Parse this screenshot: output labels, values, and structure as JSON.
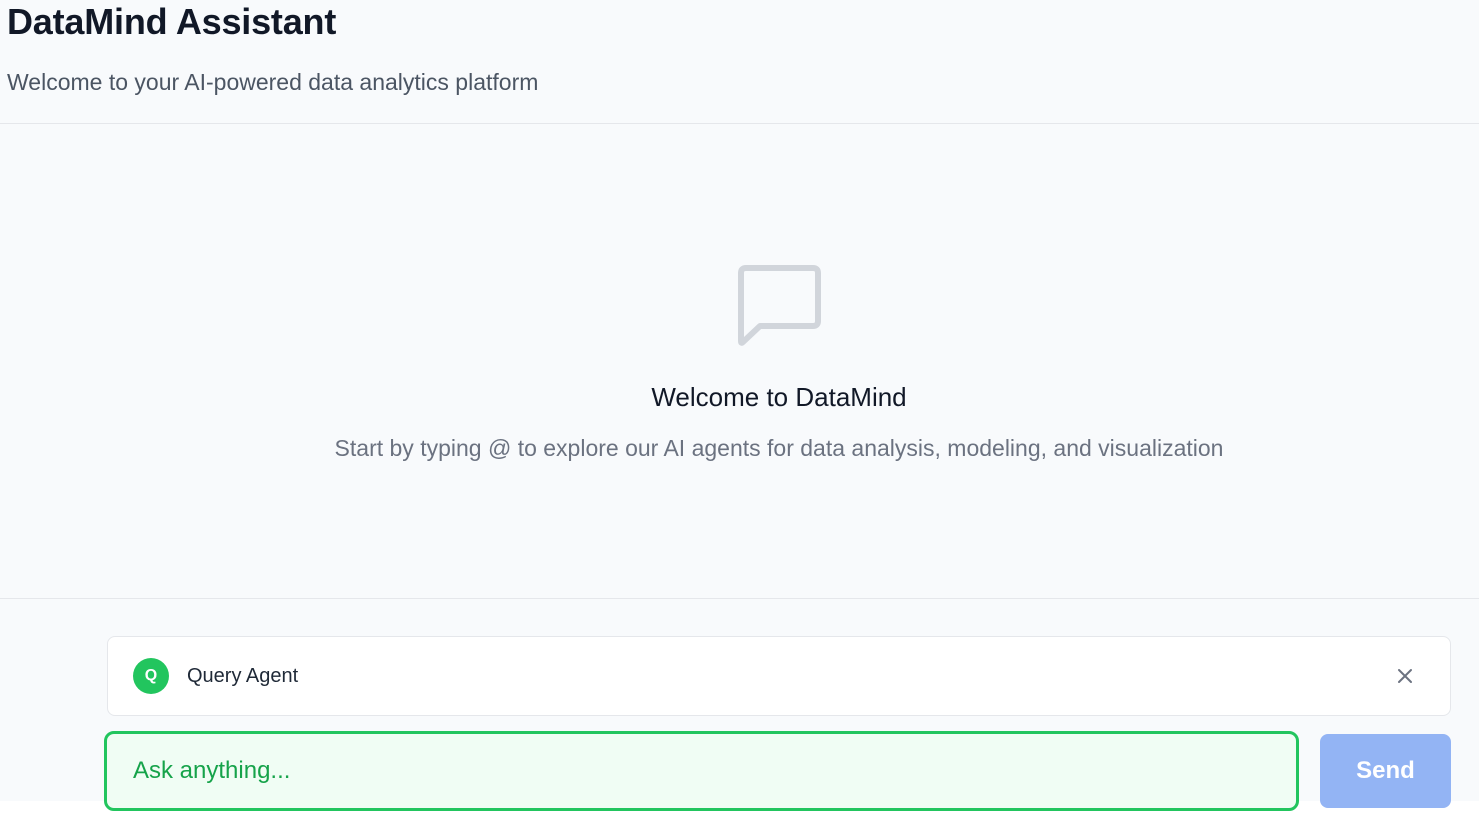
{
  "header": {
    "title": "DataMind Assistant",
    "subtitle": "Welcome to your AI-powered data analytics platform"
  },
  "empty_state": {
    "icon": "message-square-icon",
    "title": "Welcome to DataMind",
    "text": "Start by typing @ to explore our AI agents for data analysis, modeling, and visualization"
  },
  "selected_agent": {
    "initial": "Q",
    "name": "Query Agent",
    "color": "#22c55e",
    "close_icon": "close-icon"
  },
  "composer": {
    "placeholder": "Ask anything...",
    "value": "",
    "send_label": "Send",
    "accent": "#22c55e",
    "send_color": "#93b4f4"
  }
}
